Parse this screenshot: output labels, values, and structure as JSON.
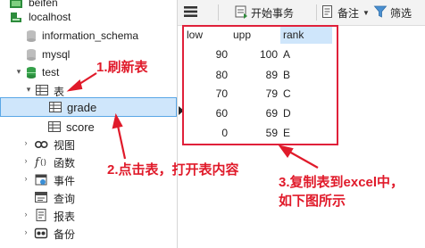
{
  "tree": {
    "items": [
      {
        "label": "beifen",
        "icon": "connection-icon"
      },
      {
        "label": "localhost",
        "icon": "connection-icon"
      },
      {
        "label": "information_schema",
        "icon": "database-icon"
      },
      {
        "label": "mysql",
        "icon": "database-icon"
      },
      {
        "label": "test",
        "icon": "database-icon"
      },
      {
        "label": "表",
        "icon": "tables-icon"
      },
      {
        "label": "grade",
        "icon": "table-icon"
      },
      {
        "label": "score",
        "icon": "table-icon"
      },
      {
        "label": "视图",
        "icon": "views-icon"
      },
      {
        "label": "函数",
        "icon": "function-icon"
      },
      {
        "label": "事件",
        "icon": "event-icon"
      },
      {
        "label": "查询",
        "icon": "query-icon"
      },
      {
        "label": "报表",
        "icon": "report-icon"
      },
      {
        "label": "备份",
        "icon": "backup-icon"
      }
    ]
  },
  "toolbar": {
    "menu_icon": "hamburger-menu-icon",
    "begin_transaction": "开始事务",
    "memo": "备注",
    "filter": "筛选"
  },
  "grid": {
    "columns": [
      "low",
      "upp",
      "rank"
    ],
    "rows": [
      [
        "90",
        "100",
        "A"
      ],
      [
        "80",
        "89",
        "B"
      ],
      [
        "70",
        "79",
        "C"
      ],
      [
        "60",
        "69",
        "D"
      ],
      [
        "0",
        "59",
        "E"
      ]
    ]
  },
  "annotations": {
    "step1": "1.刷新表",
    "step2": "2.点击表，打开表内容",
    "step3_line1": "3.复制表到excel中，",
    "step3_line2": "如下图所示"
  },
  "colors": {
    "annotation_red": "#e01a2a",
    "selection_bg": "#cfe6fb",
    "rank_header_bg": "#cfe6fb"
  }
}
